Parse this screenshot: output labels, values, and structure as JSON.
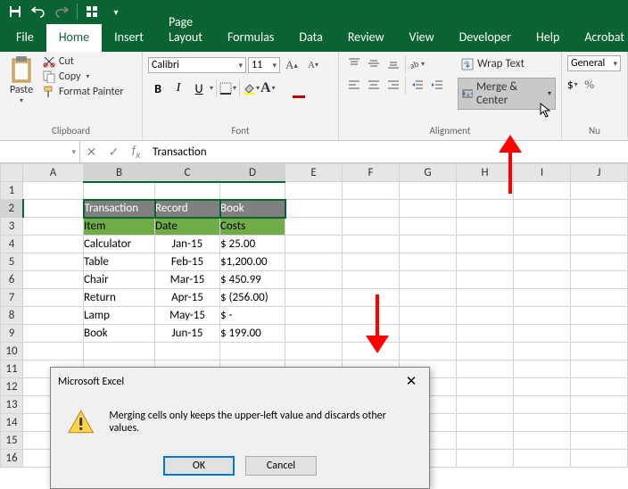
{
  "tabs": [
    "File",
    "Home",
    "Insert",
    "Page Layout",
    "Formulas",
    "Data",
    "Review",
    "View",
    "Developer",
    "Help",
    "Acrobat"
  ],
  "active_tab": "Home",
  "clipboard": {
    "cut": "Cut",
    "copy": "Copy",
    "fmt": "Format Painter",
    "paste": "Paste",
    "group": "Clipboard"
  },
  "font": {
    "name": "Calibri",
    "size": "11",
    "group": "Font"
  },
  "alignment": {
    "wrap": "Wrap Text",
    "merge": "Merge & Center",
    "group": "Alignment"
  },
  "number": {
    "fmt": "General",
    "group": "Nu"
  },
  "namebox": "",
  "formula": "Transaction",
  "columns": [
    "A",
    "B",
    "C",
    "D",
    "E",
    "F",
    "G",
    "H",
    "I",
    "J"
  ],
  "rows": [
    "1",
    "2",
    "3",
    "4",
    "5",
    "6",
    "7",
    "8",
    "9",
    "10",
    "11",
    "12",
    "13",
    "14",
    "15",
    "16"
  ],
  "table": {
    "hdr": [
      "Transaction",
      "Record",
      "Book"
    ],
    "hdr2": [
      "Item",
      "Date",
      "Costs"
    ],
    "data": [
      {
        "item": "Calculator",
        "date": "Jan-15",
        "cost": "$    25.00"
      },
      {
        "item": "Table",
        "date": "Feb-15",
        "cost": "$1,200.00"
      },
      {
        "item": "Chair",
        "date": "Mar-15",
        "cost": "$  450.99"
      },
      {
        "item": "Return",
        "date": "Apr-15",
        "cost": "$ (256.00)"
      },
      {
        "item": "Lamp",
        "date": "May-15",
        "cost": "$       -"
      },
      {
        "item": "Book",
        "date": "Jun-15",
        "cost": "$  199.00"
      }
    ]
  },
  "dialog": {
    "title": "Microsoft Excel",
    "msg": "Merging cells only keeps the upper-left value and discards other values.",
    "ok": "OK",
    "cancel": "Cancel"
  },
  "chart_data": {
    "type": "table",
    "title": "Transaction Record Book",
    "columns": [
      "Item",
      "Date",
      "Costs"
    ],
    "rows": [
      [
        "Calculator",
        "Jan-15",
        25.0
      ],
      [
        "Table",
        "Feb-15",
        1200.0
      ],
      [
        "Chair",
        "Mar-15",
        450.99
      ],
      [
        "Return",
        "Apr-15",
        -256.0
      ],
      [
        "Lamp",
        "May-15",
        0
      ],
      [
        "Book",
        "Jun-15",
        199.0
      ]
    ]
  }
}
